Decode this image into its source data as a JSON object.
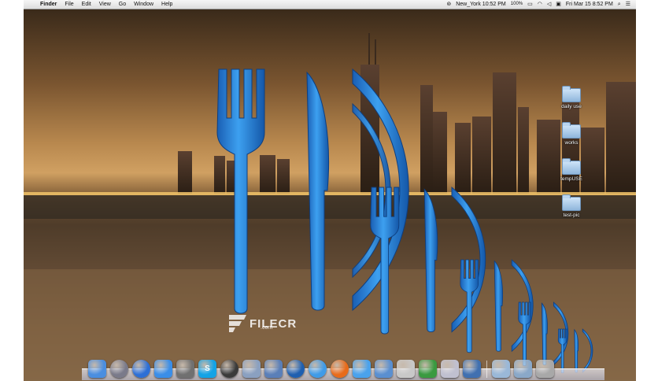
{
  "menubar": {
    "apple_glyph": "",
    "app_name": "Finder",
    "items": [
      "File",
      "Edit",
      "View",
      "Go",
      "Window",
      "Help"
    ],
    "status": {
      "clock_location": "New_York 10:52 PM",
      "battery": "100%",
      "datetime": "Fri Mar 15  8:52 PM"
    }
  },
  "desktop": {
    "items": [
      {
        "label": "daily use",
        "icon": "folder-icon"
      },
      {
        "label": "works",
        "icon": "folder-icon"
      },
      {
        "label": "tempUSE",
        "icon": "folder-icon"
      },
      {
        "label": "test-pic",
        "icon": "folder-icon"
      }
    ]
  },
  "app_icon": {
    "name": "fork-knife-plate-icon",
    "sizes_shown": 5,
    "color": "#2f8ee0"
  },
  "watermark": {
    "text": "FILECR",
    "sub": ".com"
  },
  "dock": {
    "apps": [
      {
        "name": "finder-icon",
        "color": "#4a8ee0"
      },
      {
        "name": "launchpad-icon",
        "color": "#7a7a8a"
      },
      {
        "name": "itunes-icon",
        "color": "#2d6fd6"
      },
      {
        "name": "app-store-icon",
        "color": "#3a8ee8"
      },
      {
        "name": "preview-icon",
        "color": "#707070"
      },
      {
        "name": "skype-icon",
        "color": "#13a3e6",
        "glyph": "S"
      },
      {
        "name": "dashboard-icon",
        "color": "#3a3a3a"
      },
      {
        "name": "preview-photos-icon",
        "color": "#8aa0c0"
      },
      {
        "name": "xcode-tools-icon",
        "color": "#5a7fb8"
      },
      {
        "name": "google-earth-icon",
        "color": "#1e5fb0"
      },
      {
        "name": "safari-icon",
        "color": "#3f9be8"
      },
      {
        "name": "firefox-icon",
        "color": "#e86b1a"
      },
      {
        "name": "messages-icon",
        "color": "#4aa2ec"
      },
      {
        "name": "mail-icon",
        "color": "#5a8fd0"
      },
      {
        "name": "pdf-icon",
        "color": "#c8c8c8"
      },
      {
        "name": "pencil-tool-icon",
        "color": "#3a9a40"
      },
      {
        "name": "quicktime-icon",
        "color": "#c0c0d0"
      },
      {
        "name": "eye-app-icon",
        "color": "#4070b0"
      }
    ],
    "right": [
      {
        "name": "applications-folder-icon",
        "color": "#9ab8d8"
      },
      {
        "name": "downloads-folder-icon",
        "color": "#8aa8c8"
      },
      {
        "name": "trash-icon",
        "color": "#a8a8a8"
      }
    ]
  }
}
